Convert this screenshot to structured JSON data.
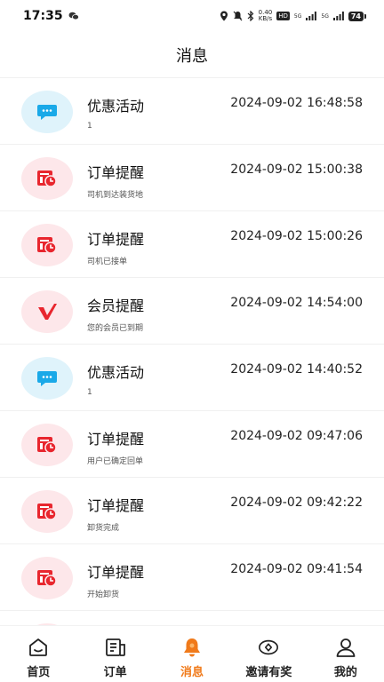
{
  "status_bar": {
    "time": "17:35",
    "net_speed_value": "0.40",
    "net_speed_unit": "KB/s",
    "hd_badge": "HD",
    "signal_label_1": "5G",
    "signal_label_2": "5G",
    "battery": "74"
  },
  "header": {
    "title": "消息"
  },
  "messages": [
    {
      "title": "优惠活动",
      "time": "2024-09-02 16:48:58",
      "subtitle": "1",
      "icon": "chat-bubble-icon",
      "color": "blue"
    },
    {
      "title": "订单提醒",
      "time": "2024-09-02 15:00:38",
      "subtitle": "司机到达装货地",
      "icon": "order-clock-icon",
      "color": "pink"
    },
    {
      "title": "订单提醒",
      "time": "2024-09-02 15:00:26",
      "subtitle": "司机已接单",
      "icon": "order-clock-icon",
      "color": "pink"
    },
    {
      "title": "会员提醒",
      "time": "2024-09-02 14:54:00",
      "subtitle": "您的会员已到期",
      "icon": "vip-v-icon",
      "color": "pink"
    },
    {
      "title": "优惠活动",
      "time": "2024-09-02 14:40:52",
      "subtitle": "1",
      "icon": "chat-bubble-icon",
      "color": "blue"
    },
    {
      "title": "订单提醒",
      "time": "2024-09-02 09:47:06",
      "subtitle": "用户已确定回单",
      "icon": "order-clock-icon",
      "color": "pink"
    },
    {
      "title": "订单提醒",
      "time": "2024-09-02 09:42:22",
      "subtitle": "卸货完成",
      "icon": "order-clock-icon",
      "color": "pink"
    },
    {
      "title": "订单提醒",
      "time": "2024-09-02 09:41:54",
      "subtitle": "开始卸货",
      "icon": "order-clock-icon",
      "color": "pink"
    }
  ],
  "tabbar": {
    "active": "消息",
    "active_color": "#f07a1a",
    "items": [
      {
        "label": "首页",
        "icon": "home-icon"
      },
      {
        "label": "订单",
        "icon": "order-list-icon"
      },
      {
        "label": "消息",
        "icon": "bell-icon"
      },
      {
        "label": "邀请有奖",
        "icon": "invite-eye-icon"
      },
      {
        "label": "我的",
        "icon": "user-icon"
      }
    ]
  },
  "colors": {
    "accent": "#f07a1a",
    "order_red": "#e8262e",
    "chat_blue": "#1aa9e8",
    "blue_bg": "#dff3fb",
    "pink_bg": "#fde7ea"
  }
}
